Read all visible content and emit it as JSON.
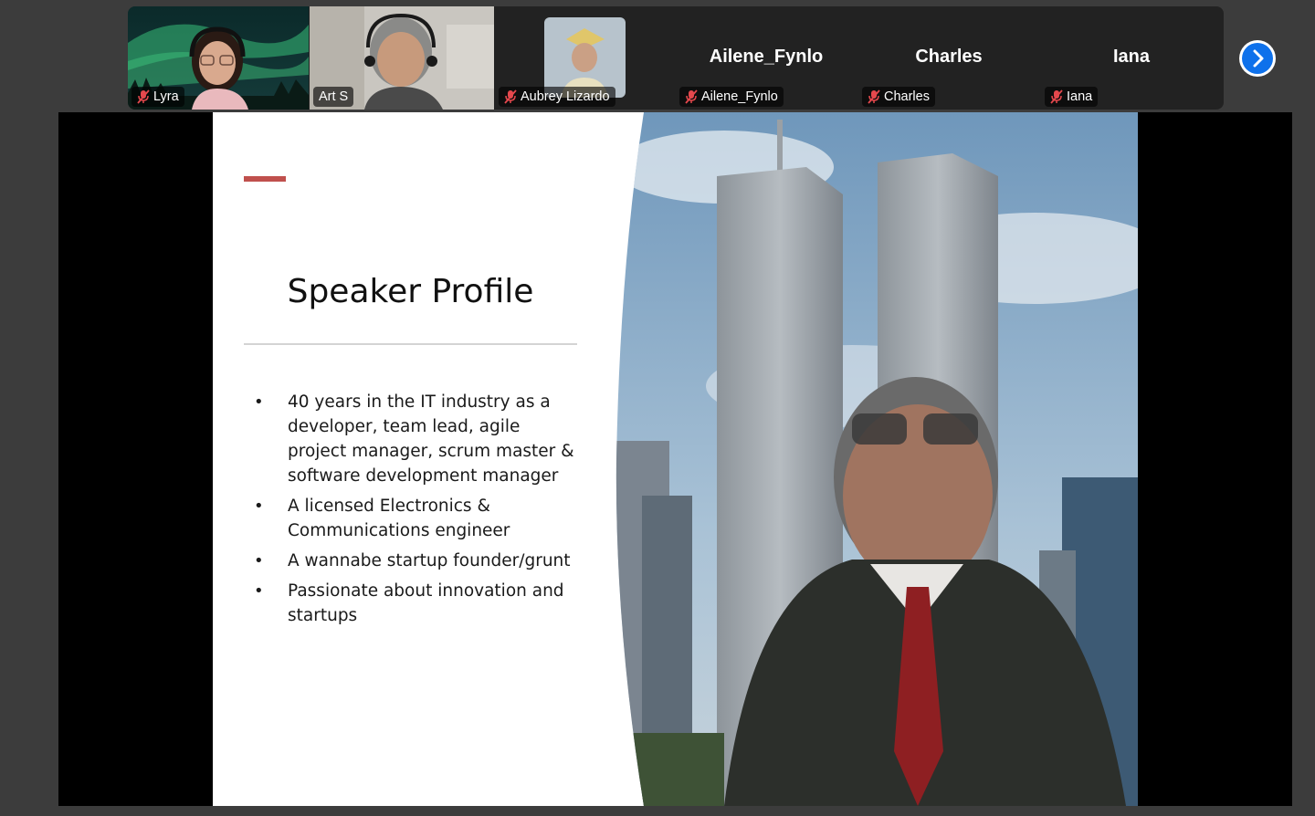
{
  "participants": [
    {
      "name": "Lyra",
      "video": true,
      "muted": true,
      "speaking": false
    },
    {
      "name": "Art S",
      "video": true,
      "muted": false,
      "speaking": true
    },
    {
      "name": "Aubrey Lizardo",
      "video": false,
      "photo": true,
      "muted": true
    },
    {
      "name": "Ailene_Fynlo",
      "display_name": "Ailene_Fynlo",
      "muted": true
    },
    {
      "name": "Charles",
      "display_name": "Charles",
      "muted": true
    },
    {
      "name": "Iana",
      "display_name": "Iana",
      "muted": true
    }
  ],
  "next_page_icon": "chevron-right-icon",
  "slide": {
    "title": "Speaker Profile",
    "bullets": [
      [
        "40 years in the IT industry as a",
        "developer, team lead, agile",
        "project manager, scrum master &",
        "software development manager"
      ],
      [
        "A licensed Electronics &",
        "Communications engineer"
      ],
      [
        "A wannabe startup founder/grunt"
      ],
      [
        "Passionate about innovation and",
        "startups"
      ]
    ],
    "bullet_lines": {
      "b0l0": "40 years in the IT industry as a",
      "b0l1": "developer, team lead, agile",
      "b0l2": "project manager, scrum master &",
      "b0l3": "software development manager",
      "b1l0": "A licensed Electronics &",
      "b1l1": "Communications engineer",
      "b2l0": "A wannabe startup founder/grunt",
      "b3l0": "Passionate about innovation and",
      "b3l1": "startups"
    }
  },
  "colors": {
    "accent": "#c0504d",
    "active_speaker": "#1fd67a",
    "mute_icon": "#e5484d",
    "next_button": "#0e71eb"
  }
}
